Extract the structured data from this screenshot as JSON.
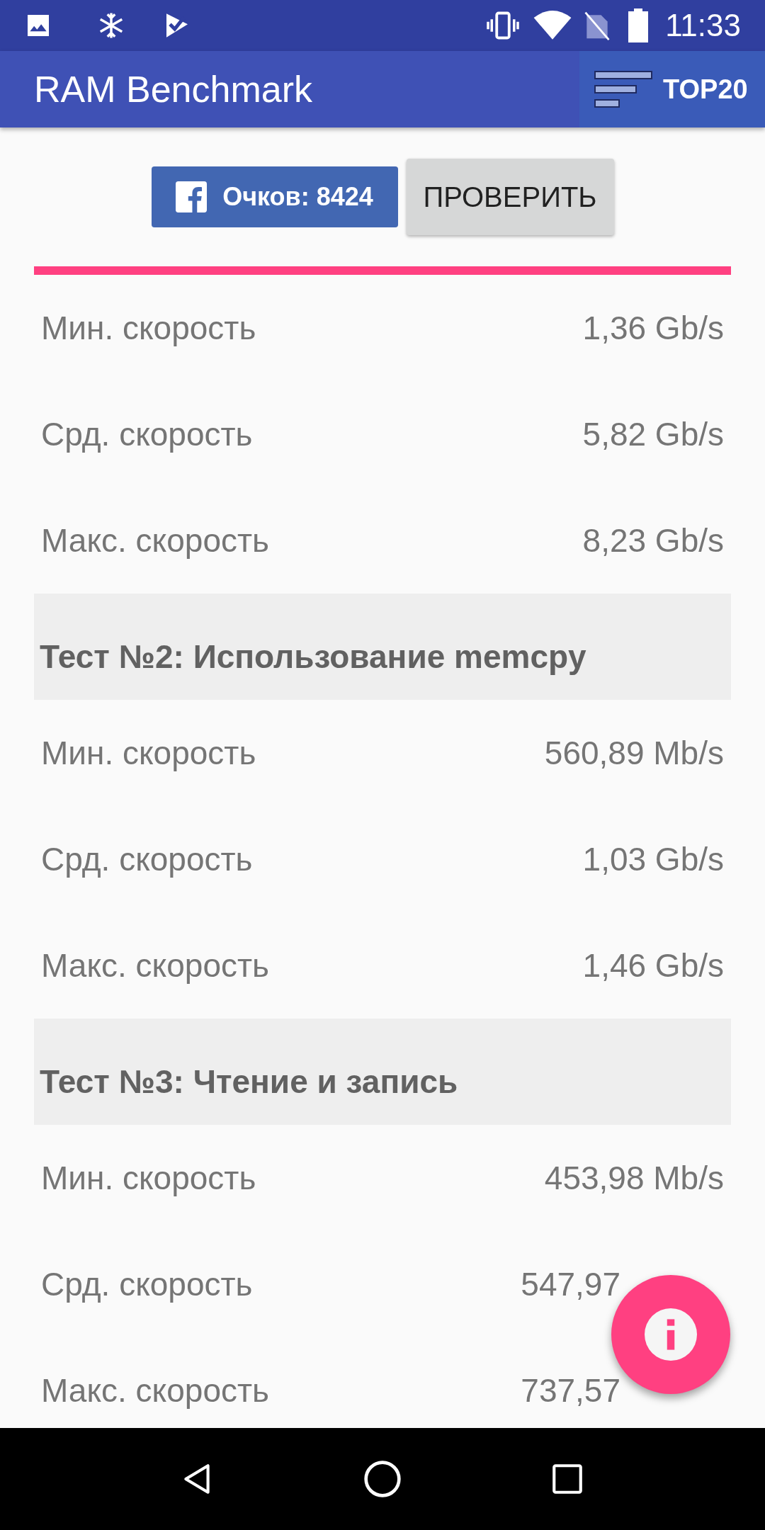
{
  "status_bar": {
    "time": "11:33"
  },
  "app_bar": {
    "title": "RAM Benchmark",
    "action": {
      "label": "TOP20"
    }
  },
  "score_button": {
    "label": "Очков: 8424"
  },
  "check_button": {
    "label": "ПРОВЕРИТЬ"
  },
  "sections": [
    {
      "rows": [
        {
          "label": "Мин. скорость",
          "value": "1,36 Gb/s"
        },
        {
          "label": "Срд. скорость",
          "value": "5,82 Gb/s"
        },
        {
          "label": "Макс. скорость",
          "value": "8,23 Gb/s"
        }
      ]
    },
    {
      "title": "Тест №2: Использование memcpy",
      "rows": [
        {
          "label": "Мин. скорость",
          "value": "560,89 Mb/s"
        },
        {
          "label": "Срд. скорость",
          "value": "1,03 Gb/s"
        },
        {
          "label": "Макс. скорость",
          "value": "1,46 Gb/s"
        }
      ]
    },
    {
      "title": "Тест №3: Чтение и запись",
      "rows": [
        {
          "label": "Мин. скорость",
          "value": "453,98 Mb/s"
        },
        {
          "label": "Срд. скорость",
          "value": "547,97"
        },
        {
          "label": "Макс. скорость",
          "value": "737,57"
        }
      ]
    }
  ]
}
